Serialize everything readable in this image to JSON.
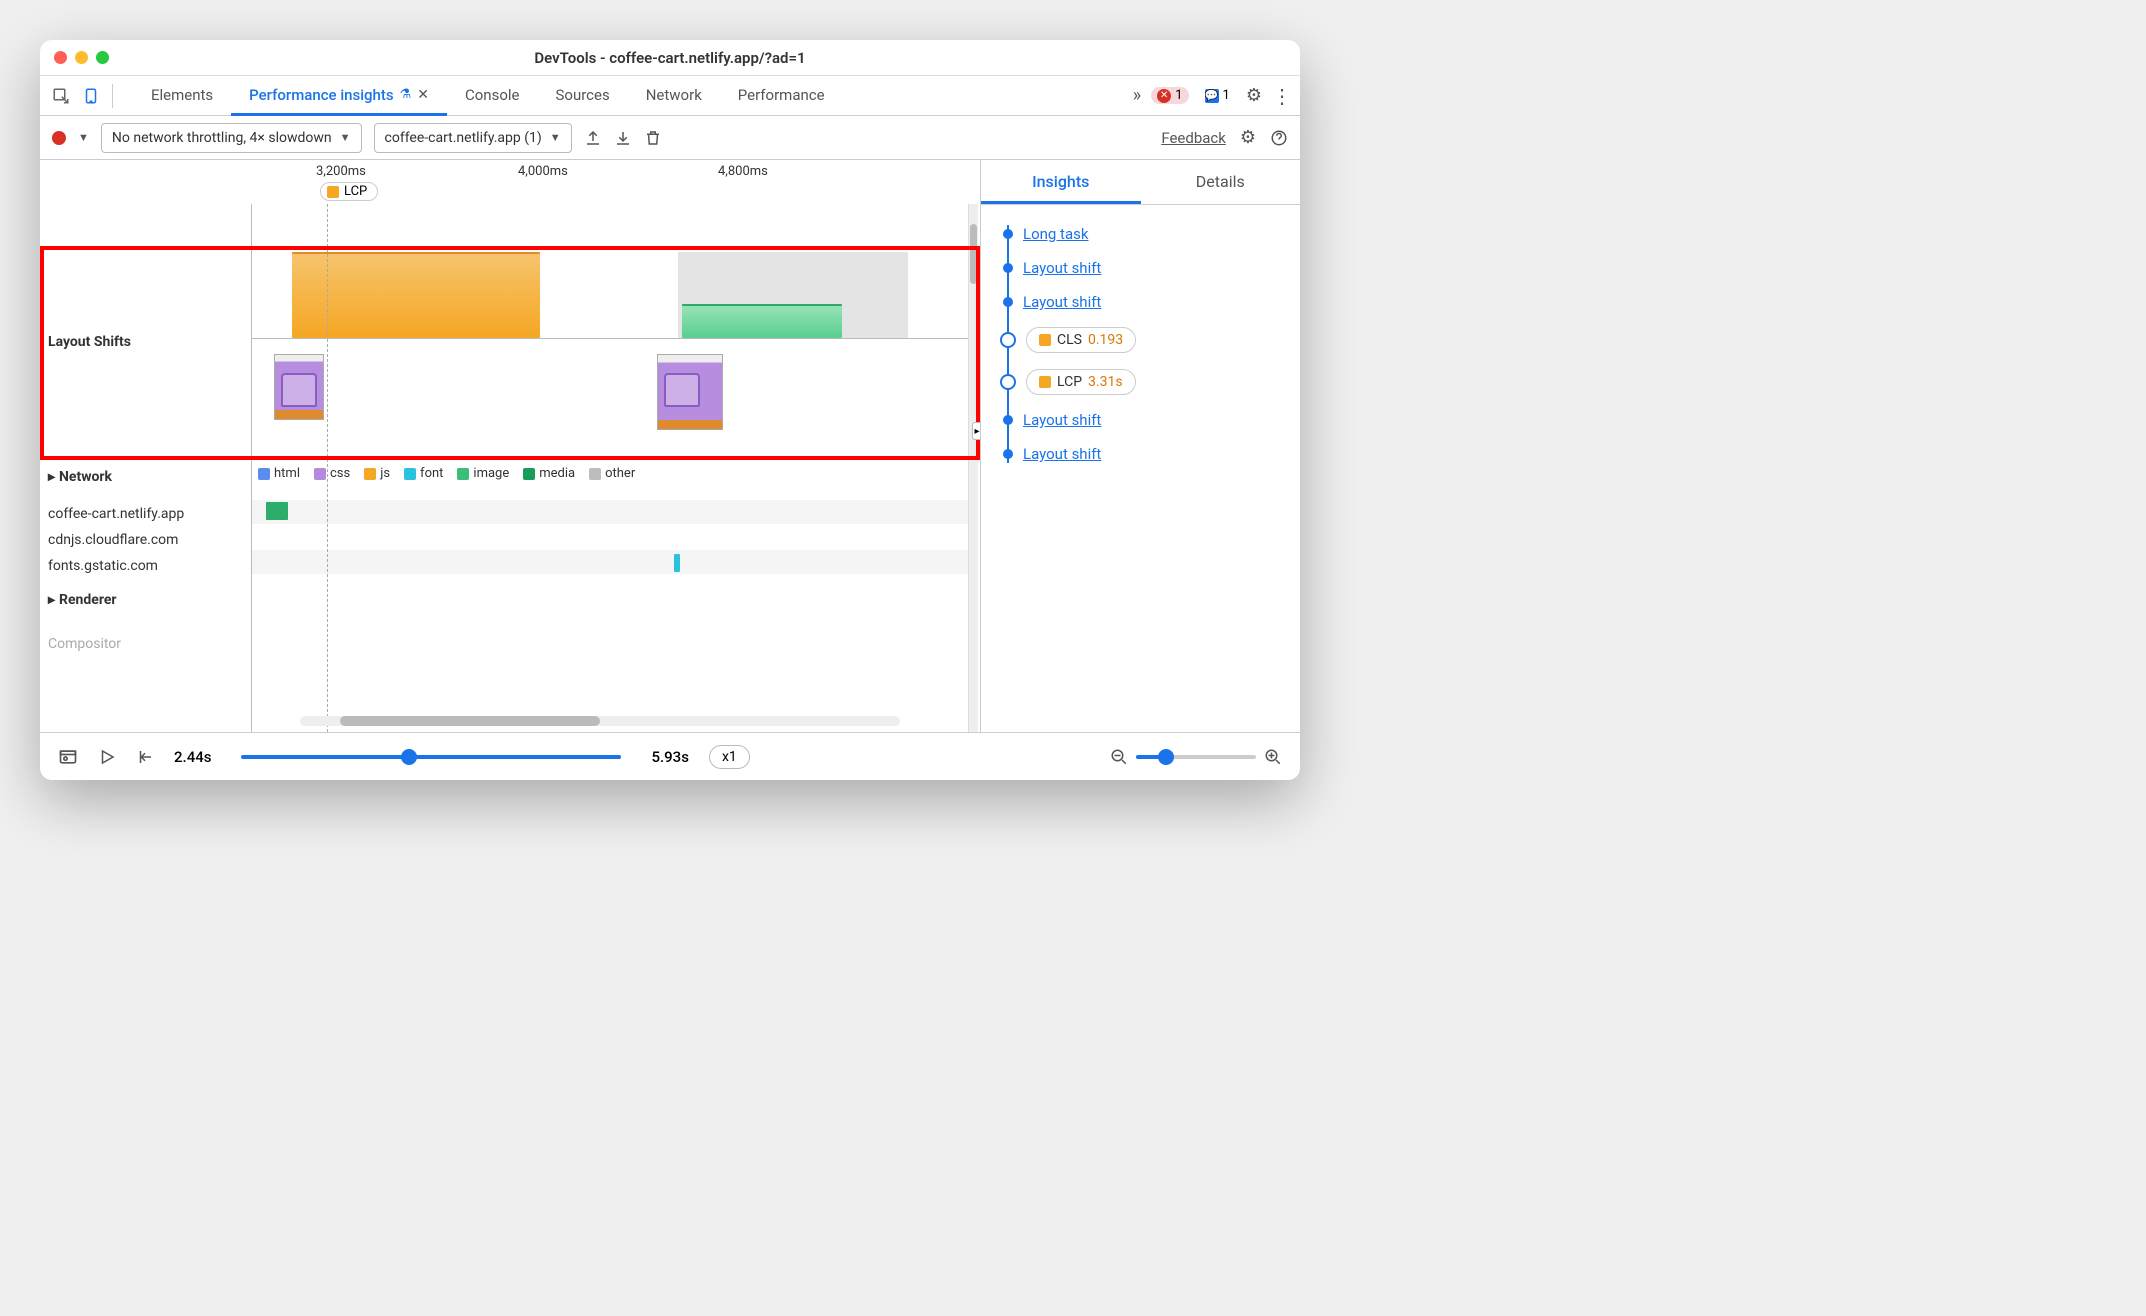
{
  "window": {
    "title": "DevTools - coffee-cart.netlify.app/?ad=1"
  },
  "tabs": {
    "elements": "Elements",
    "performance_insights": "Performance insights",
    "console": "Console",
    "sources": "Sources",
    "network": "Network",
    "performance": "Performance"
  },
  "badges": {
    "errors": "1",
    "messages": "1"
  },
  "toolbar": {
    "throttle": "No network throttling, 4× slowdown",
    "recording_select": "coffee-cart.netlify.app (1)",
    "feedback": "Feedback"
  },
  "timeline": {
    "ticks": [
      "3,200ms",
      "4,000ms",
      "4,800ms"
    ],
    "lcp_label": "LCP",
    "rows": {
      "layout_shifts": "Layout Shifts",
      "network": "Network",
      "renderer": "Renderer",
      "compositor": "Compositor"
    },
    "legend": {
      "html": "html",
      "css": "css",
      "js": "js",
      "font": "font",
      "image": "image",
      "media": "media",
      "other": "other"
    },
    "network_hosts": [
      "coffee-cart.netlify.app",
      "cdnjs.cloudflare.com",
      "fonts.gstatic.com"
    ]
  },
  "bottom": {
    "time_start": "2.44s",
    "time_end": "5.93s",
    "speed": "x1"
  },
  "insights": {
    "tabs": {
      "insights": "Insights",
      "details": "Details"
    },
    "items": {
      "long_task": "Long task",
      "layout_shift": "Layout shift",
      "cls_label": "CLS",
      "cls_value": "0.193",
      "lcp_label": "LCP",
      "lcp_value": "3.31s"
    }
  },
  "colors": {
    "html": "#5b8def",
    "css": "#b48ae0",
    "js": "#f5a623",
    "font": "#29c3e0",
    "image": "#3dbd77",
    "media": "#1a9c5a",
    "other": "#bdbdbd"
  }
}
